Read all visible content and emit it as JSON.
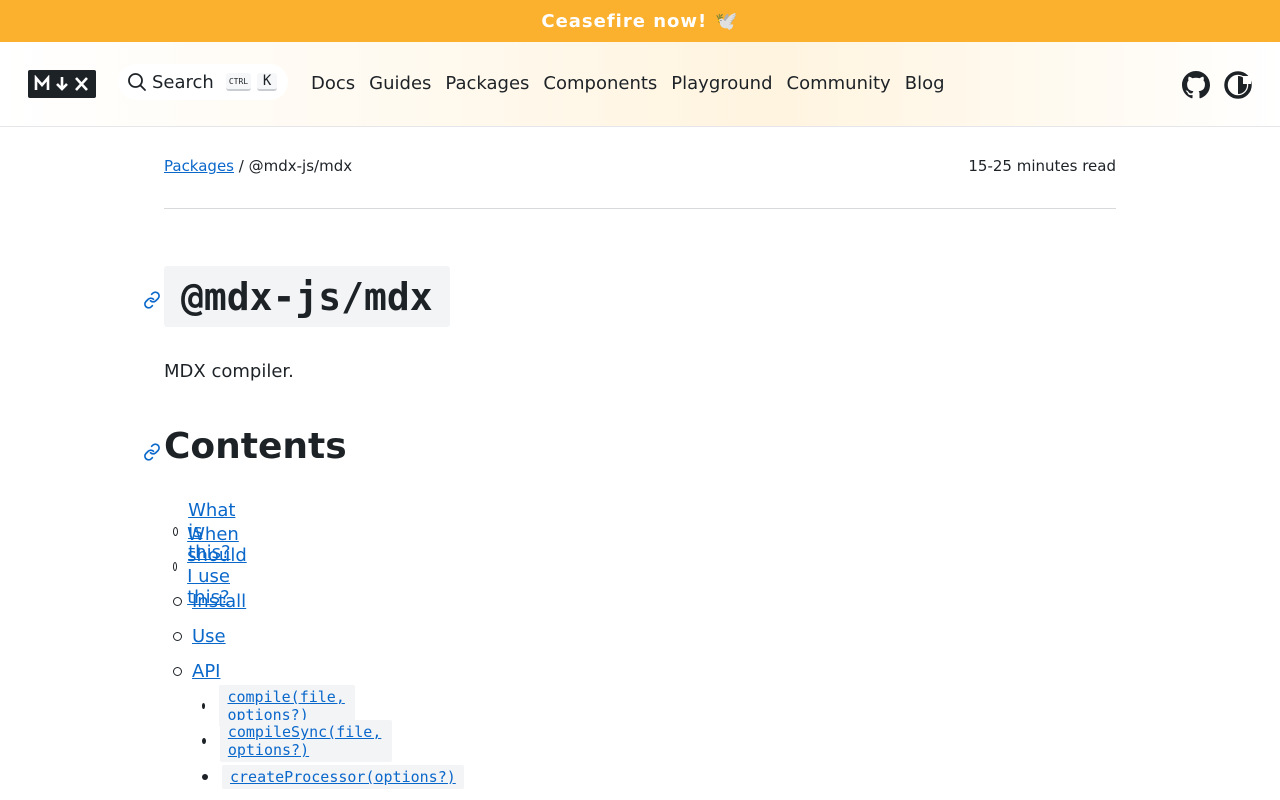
{
  "banner": {
    "text": "Ceasefire now!",
    "emoji": "🕊️"
  },
  "header": {
    "logo": "M↓X",
    "search": {
      "label": "Search",
      "kbd_ctrl": "CTRL",
      "kbd_key": "K"
    },
    "nav": [
      "Docs",
      "Guides",
      "Packages",
      "Components",
      "Playground",
      "Community",
      "Blog"
    ],
    "icons": [
      "github-icon",
      "theme-toggle-icon"
    ]
  },
  "breadcrumb": {
    "parent": "Packages",
    "separator": "/",
    "current": "@mdx-js/mdx"
  },
  "read_time": "15-25 minutes read",
  "page": {
    "title": "@mdx-js/mdx",
    "description": "MDX compiler.",
    "contents_heading": "Contents",
    "toc": [
      "What is this?",
      "When should I use this?",
      "Install",
      "Use",
      "API"
    ],
    "api_items": [
      "compile(file, options?)",
      "compileSync(file, options?)",
      "createProcessor(options?)"
    ]
  },
  "colors": {
    "banner": "#fbb12e",
    "link": "#0b68cb",
    "text": "#1d2227"
  }
}
